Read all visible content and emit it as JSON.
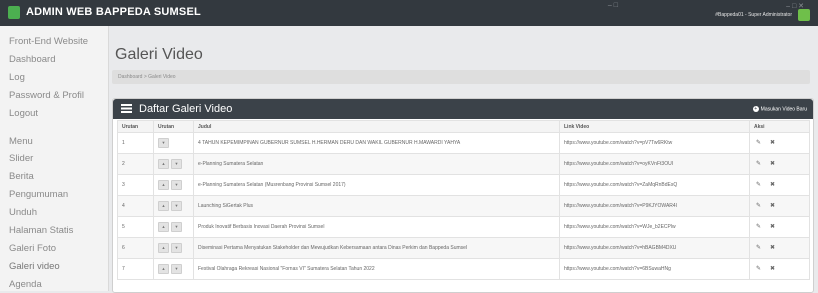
{
  "app": {
    "title": "ADMIN WEB BAPPEDA SUMSEL",
    "user": "#Bappeda01 - Super Administrator",
    "accent": "#4caf50"
  },
  "sidebar": {
    "items": [
      {
        "label": "Front-End Website"
      },
      {
        "label": "Dashboard"
      },
      {
        "label": "Log"
      },
      {
        "label": "Password & Profil"
      },
      {
        "label": "Logout"
      },
      {
        "label": "Menu"
      },
      {
        "label": "Slider"
      },
      {
        "label": "Berita"
      },
      {
        "label": "Pengumuman"
      },
      {
        "label": "Unduh"
      },
      {
        "label": "Halaman Statis"
      },
      {
        "label": "Galeri Foto"
      },
      {
        "label": "Galeri video"
      },
      {
        "label": "Agenda"
      }
    ]
  },
  "page": {
    "title": "Galeri Video",
    "breadcrumb": "Dashboard > Galeri Video"
  },
  "panel": {
    "title": "Daftar Galeri Video",
    "add_label": "Masukan Video Baru"
  },
  "table": {
    "headers": [
      "Urutan",
      "Urutan",
      "Judul",
      "Link Video",
      "Aksi"
    ],
    "rows": [
      {
        "no": "1",
        "title": "4 TAHUN KEPEMIMPINAN GUBERNUR SUMSEL H.HERMAN DERU DAN WAKIL GUBERNUR H.MAWARDI YAHYA",
        "link": "https://www.youtube.com/watch?v=pV7Tw6RKtw"
      },
      {
        "no": "2",
        "title": "e-Planning Sumatera Selatan",
        "link": "https://www.youtube.com/watch?v=oyKVnFt3OUI"
      },
      {
        "no": "3",
        "title": "e-Planning Sumatera Selatan (Musrenbang Provinsi Sumsel 2017)",
        "link": "https://www.youtube.com/watch?v=ZaMqRnBdEsQ"
      },
      {
        "no": "4",
        "title": "Launching SiGertak Plus",
        "link": "https://www.youtube.com/watch?v=P9KJYOWAR4I"
      },
      {
        "no": "5",
        "title": "Produk Inovatif Berbasis Inovasi Daerah Provinsi Sumsel",
        "link": "https://www.youtube.com/watch?v=WJe_b2ECPlw"
      },
      {
        "no": "6",
        "title": "Diseminasi Pertama Menyatukan Stakeholder dan Mewujudkan Kebersamaan antara Dinas Perkim dan Bappeda Sumsel",
        "link": "https://www.youtube.com/watch?v=hBAGBM4DXU"
      },
      {
        "no": "7",
        "title": "Festival Olahraga Rekreasi Nasional \"Fornas VI\" Sumatera Selatan Tahun 2022",
        "link": "https://www.youtube.com/watch?v=6BSuwaHNg"
      }
    ]
  }
}
